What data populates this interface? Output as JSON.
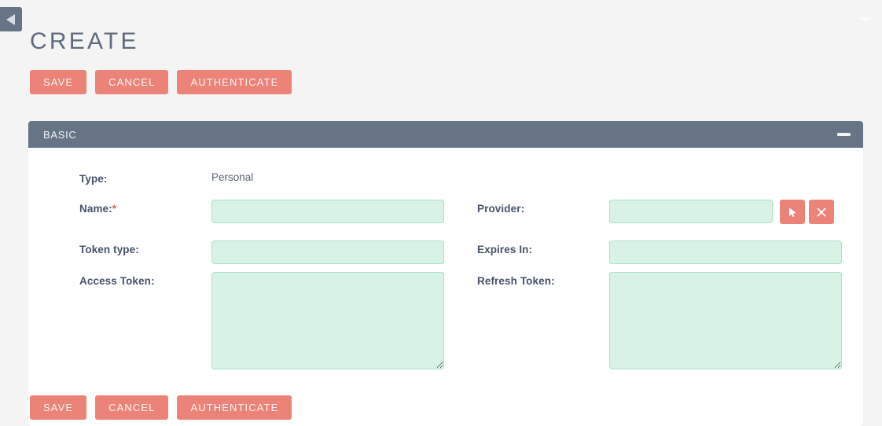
{
  "window": {
    "sidebar_toggle_icon": "triangle-left-icon",
    "top_chevron_icon": "chevron-down-icon"
  },
  "header": {
    "title": "CREATE"
  },
  "actions": {
    "save_label": "SAVE",
    "cancel_label": "CANCEL",
    "authenticate_label": "AUTHENTICATE"
  },
  "panel": {
    "title": "BASIC",
    "minimize_icon": "minimize-icon"
  },
  "form": {
    "type": {
      "label": "Type:",
      "value": "Personal"
    },
    "name": {
      "label": "Name:",
      "required_marker": "*",
      "value": "",
      "placeholder": ""
    },
    "token_type": {
      "label": "Token type:",
      "value": "",
      "placeholder": ""
    },
    "access_token": {
      "label": "Access Token:",
      "value": "",
      "placeholder": ""
    },
    "provider": {
      "label": "Provider:",
      "value": "",
      "placeholder": "",
      "select_icon": "cursor-pointer-icon",
      "clear_icon": "close-x-icon"
    },
    "expires_in": {
      "label": "Expires In:",
      "value": "",
      "placeholder": ""
    },
    "refresh_token": {
      "label": "Refresh Token:",
      "value": "",
      "placeholder": ""
    }
  },
  "colors": {
    "page_background": "#f4f4f4",
    "accent_button": "#ec8379",
    "panel_header": "#667486",
    "field_fill": "#d8f2e5",
    "field_border": "#a9e0c8",
    "label_text": "#47536a",
    "required_star": "#f2554b"
  }
}
